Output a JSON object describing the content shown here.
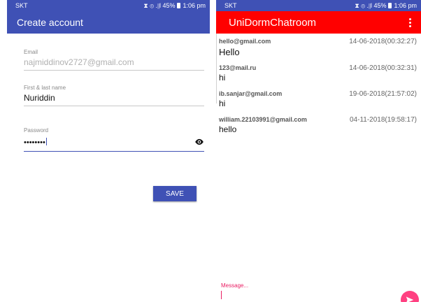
{
  "left_screen": {
    "statusbar": {
      "carrier": "SKT",
      "status": "⧗ ⊚ .∥l 45%",
      "time": "1:06 pm"
    },
    "appbar": {
      "title": "Create account"
    },
    "email": {
      "label": "Email",
      "value": "najmiddinov2727@gmail.com"
    },
    "name": {
      "label": "First & last name",
      "value": "Nuriddin"
    },
    "password": {
      "label": "Password",
      "value": "••••••••"
    },
    "save_label": "SAVE"
  },
  "right_screen": {
    "statusbar": {
      "carrier": "SKT",
      "status": "⧗ ⊚ .∥l 45%",
      "time": "1:06 pm"
    },
    "appbar": {
      "title": "UniDormChatroom"
    },
    "messages": [
      {
        "sender": "hello@gmail.com",
        "time": "14-06-2018(00:32:27)",
        "text": "Hello"
      },
      {
        "sender": "123@mail.ru",
        "time": "14-06-2018(00:32:31)",
        "text": "hi"
      },
      {
        "sender": "ib.sanjar@gmail.com",
        "time": "19-06-2018(21:57:02)",
        "text": "hi"
      },
      {
        "sender": "william.22103991@gmail.com",
        "time": "04-11-2018(19:58:17)",
        "text": "hello"
      }
    ],
    "compose": {
      "label": "Message..."
    }
  },
  "colors": {
    "primary": "#3f51b5",
    "chat_appbar": "#ff0000",
    "accent": "#ff4081"
  }
}
